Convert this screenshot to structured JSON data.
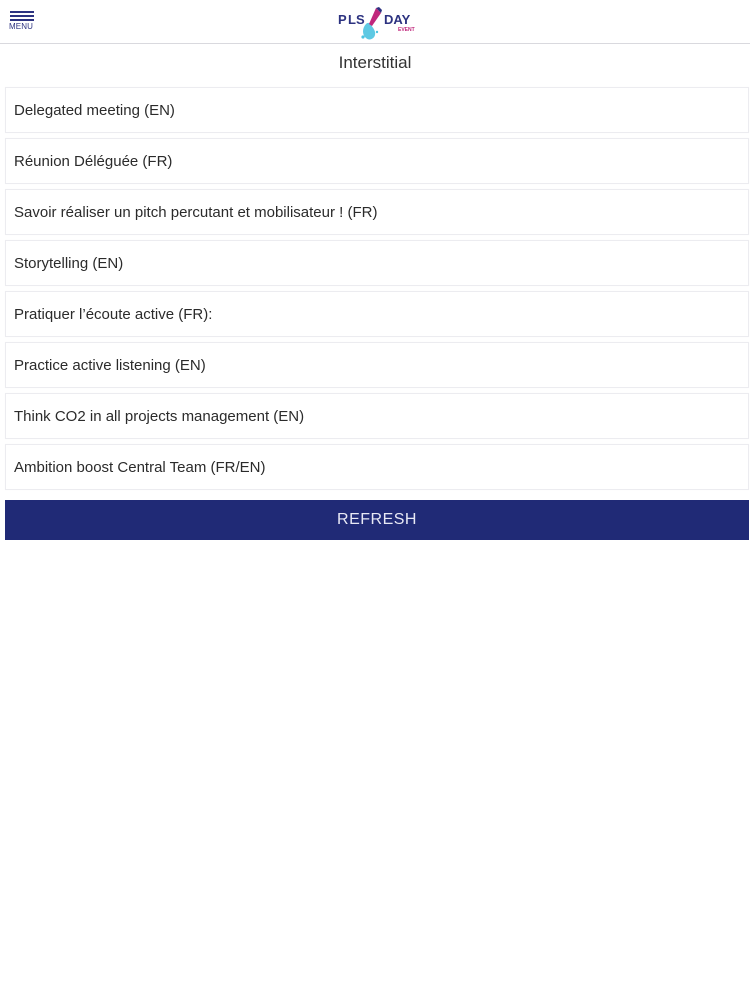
{
  "header": {
    "menu_label": "MENU",
    "logo": {
      "text_left": "P",
      "text_mid": "LS",
      "text_right": "DAY",
      "sub": "EVENT"
    }
  },
  "page": {
    "title": "Interstitial"
  },
  "sessions": [
    {
      "label": "Delegated meeting (EN)"
    },
    {
      "label": "Réunion Déléguée (FR)"
    },
    {
      "label": "Savoir réaliser un pitch percutant et mobilisateur ! (FR)"
    },
    {
      "label": "Storytelling (EN)"
    },
    {
      "label": "Pratiquer l’écoute active (FR):"
    },
    {
      "label": "Practice active listening (EN)"
    },
    {
      "label": "Think CO2 in all projects management (EN)"
    },
    {
      "label": "Ambition boost Central Team (FR/EN)"
    }
  ],
  "actions": {
    "refresh_label": "REFRESH"
  },
  "colors": {
    "brand_navy": "#202a76",
    "brand_pink": "#c0277c",
    "brand_cyan": "#4cc3e0"
  }
}
